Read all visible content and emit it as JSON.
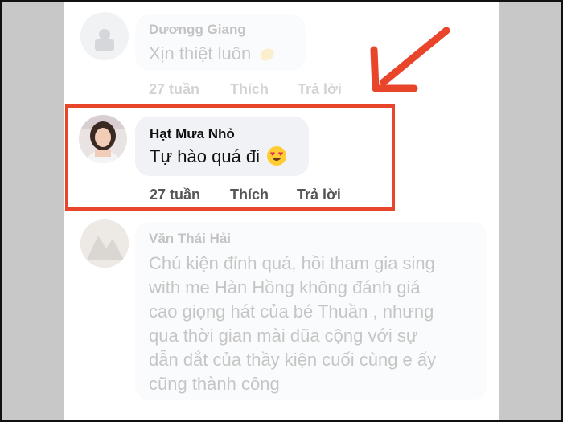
{
  "comments": [
    {
      "author": "Dươngg Giang",
      "message": "Xịn thiệt luôn",
      "emoji": "clapping-hands-icon",
      "time": "27 tuần",
      "like": "Thích",
      "reply": "Trả lời",
      "faded": true
    },
    {
      "author": "Hạt Mưa Nhỏ",
      "message": "Tự hào quá đi",
      "emoji": "heart-eyes-icon",
      "time": "27 tuần",
      "like": "Thích",
      "reply": "Trả lời",
      "faded": false
    },
    {
      "author": "Văn Thái Hải",
      "message_lines": [
        "Chú kiện đỉnh quá, hồi tham gia sing",
        "with me Hàn Hồng không đánh giá",
        "cao giọng hát của bé Thuần , nhưng",
        "qua thời gian mài dũa cộng với sự",
        "dẫn dắt của thầy kiện cuối cùng e ấy",
        "cũng thành công"
      ],
      "faded": true
    }
  ],
  "annotation": {
    "color": "#e8452b",
    "arrow_icon": "arrow-down-left-icon"
  }
}
